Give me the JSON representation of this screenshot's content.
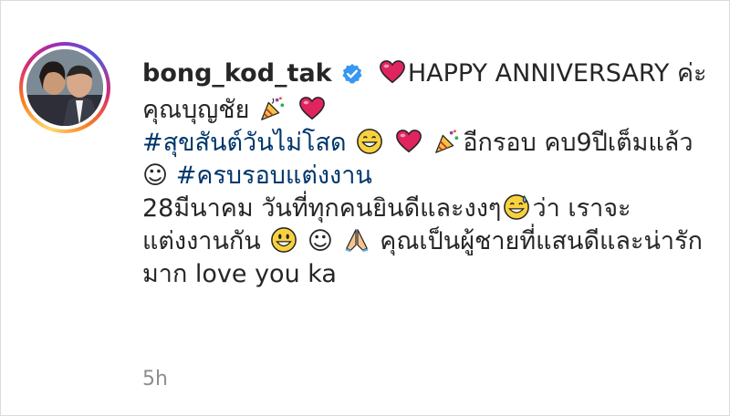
{
  "post": {
    "username": "bong_kod_tak",
    "caption": {
      "part1": "HAPPY ANNIVERSARY ค่ะคุณบุญชัย",
      "hashtag1": "#สุขสันต์วันไม่โสด",
      "part2": "อีกรอบ คบ9ปีเต็มแล้ว ☺",
      "hashtag2": "#ครบรอบแต่งงาน",
      "part3": "28มีนาคม วันที่ทุกคนยินดีและงงๆ",
      "part4": "ว่า เราจะแต่งงานกัน",
      "part5": "☺",
      "part6": "คุณเป็นผู้ชายที่แสนดีและน่ารักมาก love you ka"
    },
    "timestamp": "5h"
  },
  "icons": {
    "verified": "verified-badge-icon",
    "heart": "red-heart-emoji",
    "party": "party-popper-emoji",
    "grin": "grinning-face-emoji",
    "sweat": "grinning-sweat-emoji",
    "smiley": "smiley-face-emoji",
    "pray": "folded-hands-emoji"
  },
  "colors": {
    "verified": "#3897f0",
    "hashtag": "#00376b",
    "timestamp": "#8e8e8e",
    "heart": "#e0245e"
  }
}
